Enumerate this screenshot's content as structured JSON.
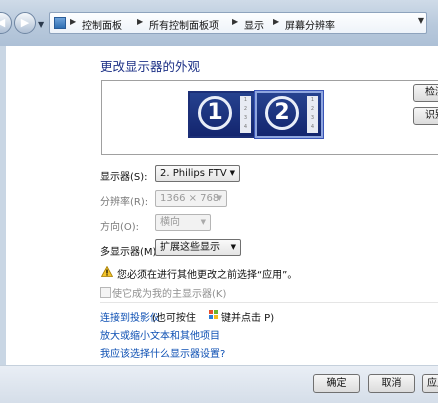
{
  "address_bar": {
    "crumbs": [
      "控制面板",
      "所有控制面板项",
      "显示",
      "屏幕分辨率"
    ]
  },
  "page": {
    "title": "更改显示器的外观"
  },
  "preview": {
    "monitors": [
      {
        "number": "1",
        "strip": [
          "1",
          "2",
          "3",
          "4"
        ]
      },
      {
        "number": "2",
        "strip": [
          "1",
          "2",
          "3",
          "4"
        ]
      }
    ],
    "detect_label": "检测",
    "identify_label": "识别"
  },
  "settings": {
    "display": {
      "label": "显示器(S):",
      "value": "2. Philips FTV"
    },
    "resolution": {
      "label": "分辨率(R):",
      "value": "1366 × 768"
    },
    "orientation": {
      "label": "方向(O):",
      "value": "横向"
    },
    "multiple": {
      "label": "多显示器(M):",
      "value": "扩展这些显示"
    }
  },
  "warning": {
    "icon": "warning-icon",
    "text": "您必须在进行其他更改之前选择“应用”。"
  },
  "main_display_checkbox": {
    "label": "使它成为我的主显示器(K)",
    "checked": false
  },
  "links": {
    "projector": "连接到投影仪",
    "projector_hint_before": "(也可按住",
    "projector_hint_after": "键并点击 P)",
    "text_size": "放大或缩小文本和其他项目",
    "which_settings": "我应该选择什么显示器设置?"
  },
  "buttons": {
    "ok": "确定",
    "cancel": "取消",
    "apply": "应用"
  }
}
